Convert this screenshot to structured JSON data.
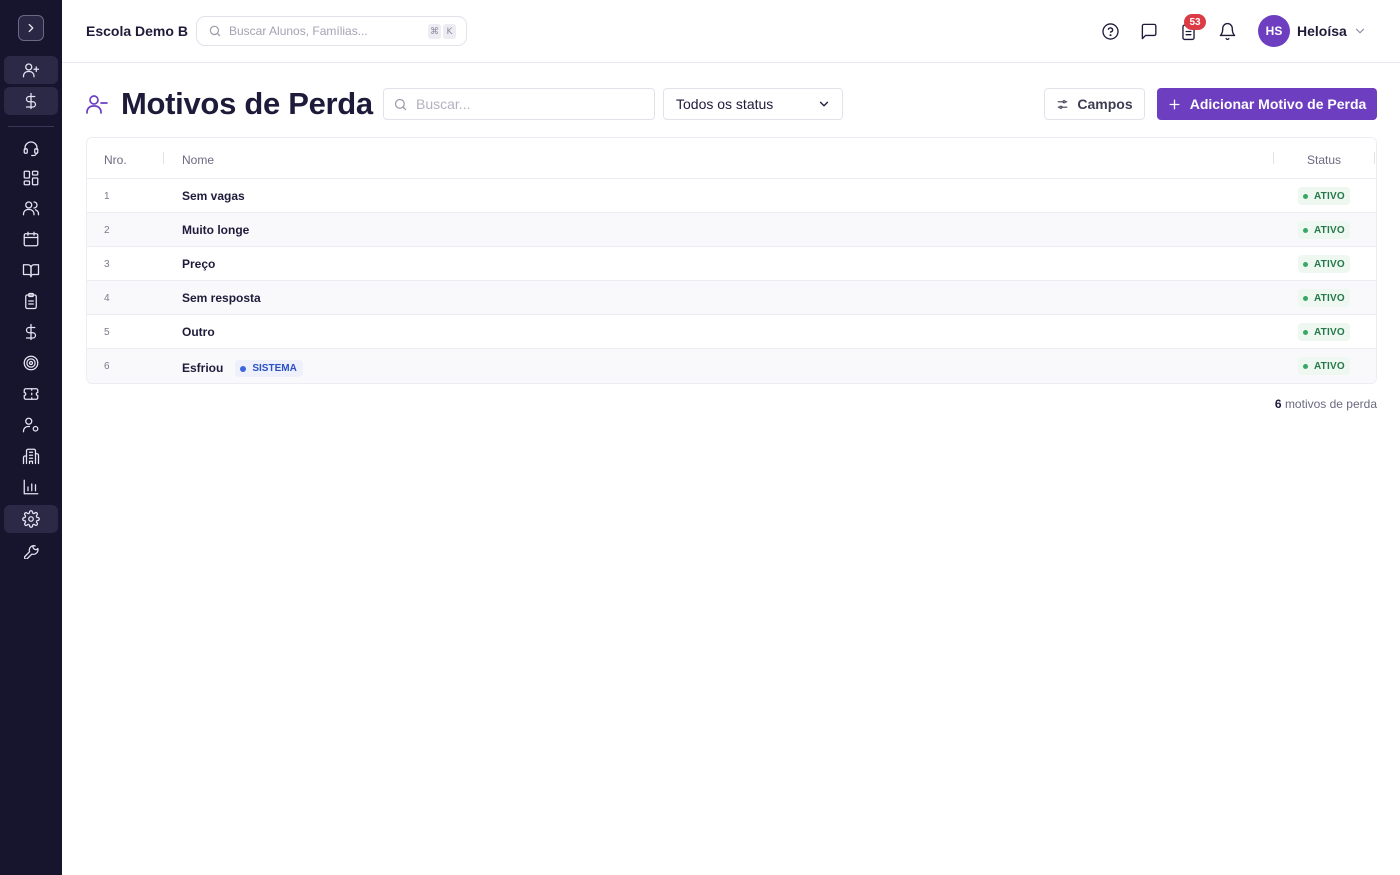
{
  "app": {
    "school_name": "Escola Demo B",
    "global_search_placeholder": "Buscar Alunos, Famílias...",
    "shortcut_keys": [
      "⌘",
      "K"
    ],
    "notification_count": "53",
    "user": {
      "initials": "HS",
      "name": "Heloísa"
    }
  },
  "sidebar": {
    "icons": [
      "chevron-right-icon",
      "user-plus-icon",
      "dollar-icon",
      "headset-icon",
      "dashboard-icon",
      "users-icon",
      "calendar-icon",
      "book-open-icon",
      "clipboard-icon",
      "dollar-icon",
      "target-icon",
      "ticket-icon",
      "user-settings-icon",
      "building-icon",
      "bar-chart-icon",
      "gear-icon",
      "wrench-icon"
    ],
    "active_item": "gear-icon"
  },
  "page": {
    "title": "Motivos de Perda",
    "search_placeholder": "Buscar...",
    "status_filter": "Todos os status",
    "fields_button": "Campos",
    "add_button": "Adicionar Motivo de Perda"
  },
  "table": {
    "columns": {
      "number": "Nro.",
      "name": "Nome",
      "status": "Status"
    },
    "rows": [
      {
        "number": "1",
        "name": "Sem vagas",
        "tag": "",
        "status": "ATIVO"
      },
      {
        "number": "2",
        "name": "Muito longe",
        "tag": "",
        "status": "ATIVO"
      },
      {
        "number": "3",
        "name": "Preço",
        "tag": "",
        "status": "ATIVO"
      },
      {
        "number": "4",
        "name": "Sem resposta",
        "tag": "",
        "status": "ATIVO"
      },
      {
        "number": "5",
        "name": "Outro",
        "tag": "",
        "status": "ATIVO"
      },
      {
        "number": "6",
        "name": "Esfriou",
        "tag": "SISTEMA",
        "status": "ATIVO"
      }
    ],
    "footer": {
      "count": "6",
      "label": "motivos de perda"
    }
  },
  "colors": {
    "sidebar_bg": "#17152e",
    "accent": "#6d3fc0",
    "status_active": "#25784a",
    "system_tag": "#2b4fc4",
    "badge": "#dc3b46"
  }
}
